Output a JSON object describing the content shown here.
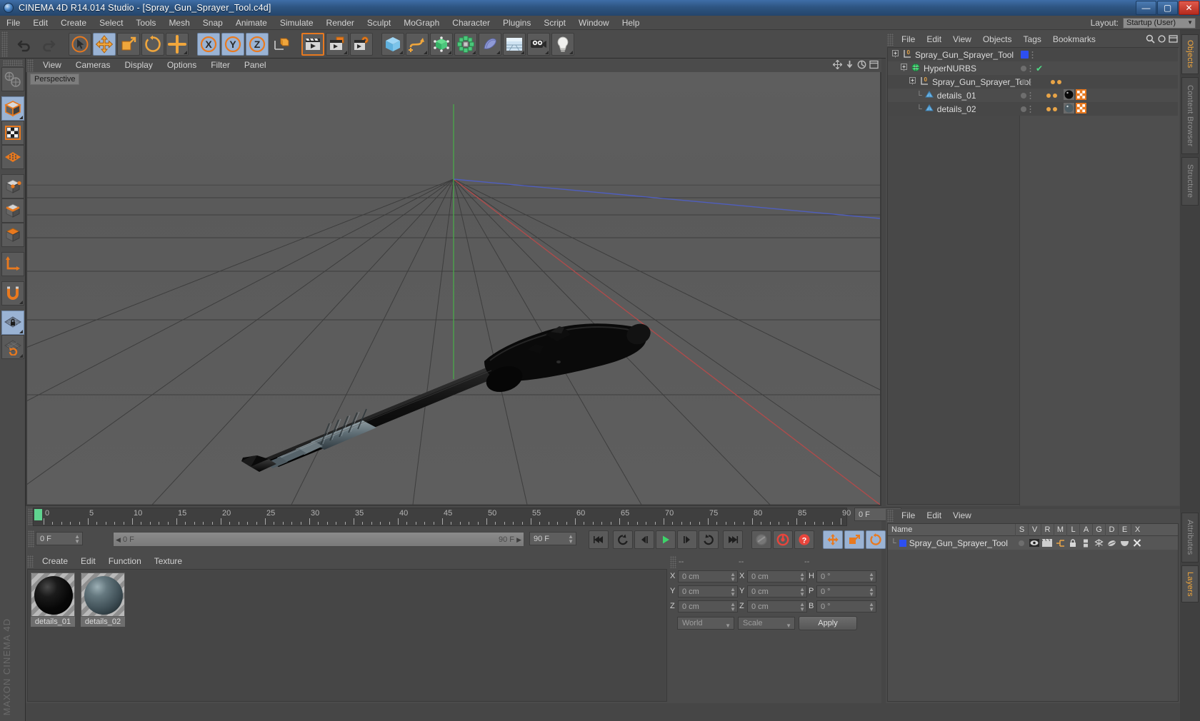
{
  "window": {
    "title": "CINEMA 4D R14.014 Studio - [Spray_Gun_Sprayer_Tool.c4d]",
    "minimize": "—",
    "maximize": "▢",
    "close": "✕"
  },
  "menubar": {
    "items": [
      "File",
      "Edit",
      "Create",
      "Select",
      "Tools",
      "Mesh",
      "Snap",
      "Animate",
      "Simulate",
      "Render",
      "Sculpt",
      "MoGraph",
      "Character",
      "Plugins",
      "Script",
      "Window",
      "Help"
    ],
    "layout_label": "Layout:",
    "layout_value": "Startup (User)"
  },
  "viewport": {
    "menu": [
      "View",
      "Cameras",
      "Display",
      "Options",
      "Filter",
      "Panel"
    ],
    "badge": "Perspective",
    "axis_labels": {
      "x": "X",
      "y": "Y",
      "z": "Z"
    }
  },
  "timeline": {
    "ticks": [
      "0",
      "5",
      "10",
      "15",
      "20",
      "25",
      "30",
      "35",
      "40",
      "45",
      "50",
      "55",
      "60",
      "65",
      "70",
      "75",
      "80",
      "85",
      "90"
    ],
    "current_frame_right": "0 F",
    "start_field": "0 F",
    "bar_left": "0 F",
    "bar_right": "90 F",
    "end_field": "90 F"
  },
  "materials": {
    "menu": [
      "Create",
      "Edit",
      "Function",
      "Texture"
    ],
    "items": [
      {
        "name": "details_01",
        "color": "#0d0d0d"
      },
      {
        "name": "details_02",
        "color": "#5d6f74"
      }
    ]
  },
  "coordinates": {
    "header": [
      "--",
      "--",
      "--"
    ],
    "rows": [
      {
        "l1": "X",
        "v1": "0 cm",
        "l2": "X",
        "v2": "0 cm",
        "l3": "H",
        "v3": "0 °"
      },
      {
        "l1": "Y",
        "v1": "0 cm",
        "l2": "Y",
        "v2": "0 cm",
        "l3": "P",
        "v3": "0 °"
      },
      {
        "l1": "Z",
        "v1": "0 cm",
        "l2": "Z",
        "v2": "0 cm",
        "l3": "B",
        "v3": "0 °"
      }
    ],
    "system": "World",
    "mode": "Scale",
    "apply": "Apply"
  },
  "objects": {
    "menu": [
      "File",
      "Edit",
      "View",
      "Objects",
      "Tags",
      "Bookmarks"
    ],
    "rows": [
      {
        "label": "Spray_Gun_Sprayer_Tool",
        "indent": 0,
        "icon": "null-object-icon"
      },
      {
        "label": "HyperNURBS",
        "indent": 1,
        "icon": "hypernurbs-icon"
      },
      {
        "label": "Spray_Gun_Sprayer_Tool",
        "indent": 2,
        "icon": "null-object-icon"
      },
      {
        "label": "details_01",
        "indent": 3,
        "icon": "polygon-object-icon"
      },
      {
        "label": "details_02",
        "indent": 3,
        "icon": "polygon-object-icon"
      }
    ]
  },
  "attributes": {
    "menu": [
      "File",
      "Edit",
      "View"
    ],
    "columns": [
      "Name",
      "S",
      "V",
      "R",
      "M",
      "L",
      "A",
      "G",
      "D",
      "E",
      "X"
    ],
    "row_name": "Spray_Gun_Sprayer_Tool"
  },
  "right_tabs": {
    "top": [
      "Objects",
      "Content Browser",
      "Structure"
    ],
    "bottom": [
      "Attributes",
      "Layers"
    ]
  },
  "watermark": {
    "brand": "MAXON",
    "product": "CINEMA 4D"
  },
  "colors": {
    "accent_orange": "#f0a63c",
    "selection_blue": "#9ab3d4",
    "object_blue": "#2d4ff0",
    "green_check": "#4edc86",
    "axis_x": "#d93b3b",
    "axis_y": "#3fc23f",
    "axis_z": "#3b5bd9"
  }
}
